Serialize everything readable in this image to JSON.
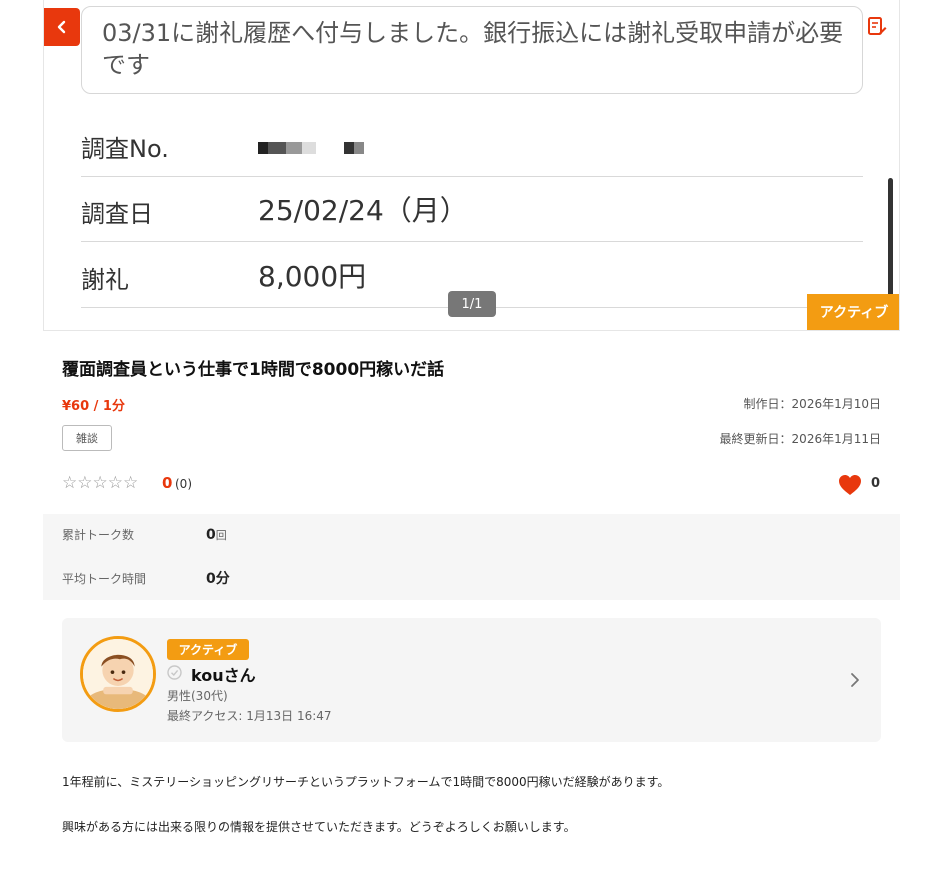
{
  "gallery": {
    "message": "03/31に謝礼履歴へ付与しました。銀行振込には謝礼受取申請が必要です",
    "rows": [
      {
        "label": "調査No.",
        "value": ""
      },
      {
        "label": "調査日",
        "value": "25/02/24（月）"
      },
      {
        "label": "謝礼",
        "value": "8,000円"
      }
    ],
    "page_indicator": "1/1",
    "status_badge": "アクティブ"
  },
  "listing": {
    "title": "覆面調査員という仕事で1時間で8000円稼いだ話",
    "price": "¥60 / 1分",
    "created": "制作日：2026年1月10日",
    "updated": "最終更新日：2026年1月11日",
    "tag": "雑談",
    "stars": "☆☆☆☆☆",
    "rating": "0",
    "rating_count": "(0)",
    "likes": "0"
  },
  "stats": {
    "total_talks_label": "累計トーク数",
    "total_talks_value": "0",
    "total_talks_unit": "回",
    "avg_time_label": "平均トーク時間",
    "avg_time_value": "0分"
  },
  "user": {
    "status": "アクティブ",
    "name": "kouさん",
    "gender": "男性(30代)",
    "last_access": "最終アクセス: 1月13日 16:47"
  },
  "description": {
    "line1": "1年程前に、ミステリーショッピングリサーチというプラットフォームで1時間で8000円稼いだ経験があります。",
    "line2": "興味がある方には出来る限りの情報を提供させていただきます。どうぞよろしくお願いします。"
  },
  "colors": {
    "accent_red": "#e8380d",
    "accent_orange": "#f39c12"
  },
  "icons": [
    "back-arrow-icon",
    "edit-note-icon",
    "heart-icon",
    "verified-check-icon",
    "chevron-right-icon"
  ]
}
